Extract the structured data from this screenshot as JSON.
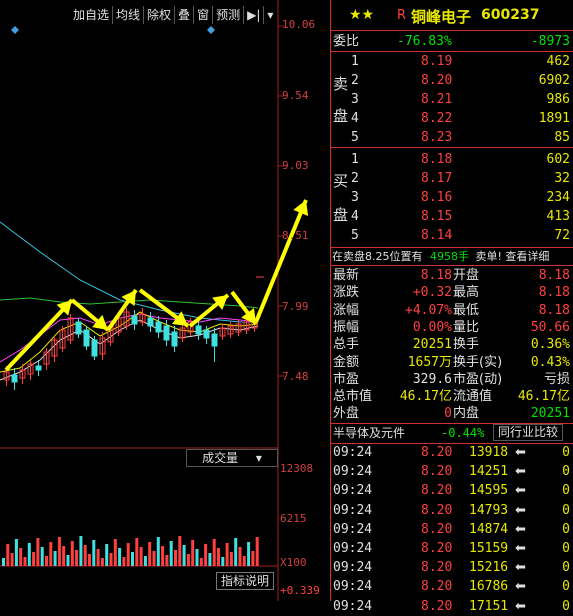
{
  "toolbar": {
    "items": [
      "加自选",
      "均线",
      "除权",
      "叠",
      "窗",
      "预测"
    ],
    "more_icon": "arrow-to-right-icon"
  },
  "price_axis": [
    "10.06",
    "9.54",
    "9.03",
    "8.51",
    "7.99",
    "7.48"
  ],
  "volume_axis": [
    "12308",
    "6215"
  ],
  "volume_unit": "X100",
  "indicator_value": "+0.339",
  "indicator_select": "成交量",
  "indicator_help": "指标说明",
  "header": {
    "stars": "★★",
    "flag": "R",
    "name": "铜峰电子",
    "code": "600237"
  },
  "weibi": {
    "label": "委比",
    "pct": "-76.83%",
    "diff": "-8973"
  },
  "sell": {
    "label": [
      "卖",
      "盘"
    ],
    "levels": [
      {
        "n": "5",
        "price": "8.23",
        "vol": "85"
      },
      {
        "n": "4",
        "price": "8.22",
        "vol": "1891"
      },
      {
        "n": "3",
        "price": "8.21",
        "vol": "986"
      },
      {
        "n": "2",
        "price": "8.20",
        "vol": "6902"
      },
      {
        "n": "1",
        "price": "8.19",
        "vol": "462"
      }
    ]
  },
  "buy": {
    "label": [
      "买",
      "盘"
    ],
    "levels": [
      {
        "n": "1",
        "price": "8.18",
        "vol": "602"
      },
      {
        "n": "2",
        "price": "8.17",
        "vol": "32"
      },
      {
        "n": "3",
        "price": "8.16",
        "vol": "234"
      },
      {
        "n": "4",
        "price": "8.15",
        "vol": "413"
      },
      {
        "n": "5",
        "price": "8.14",
        "vol": "72"
      }
    ]
  },
  "notice": {
    "text": "在卖盘8.25位置有",
    "vol": "4958手",
    "action": "卖单!",
    "link": "查看详细"
  },
  "stats": [
    {
      "l1": "最新",
      "v1": "8.18",
      "c1": "red",
      "l2": "开盘",
      "v2": "8.18",
      "c2": "red"
    },
    {
      "l1": "涨跌",
      "v1": "+0.32",
      "c1": "red",
      "l2": "最高",
      "v2": "8.18",
      "c2": "red"
    },
    {
      "l1": "涨幅",
      "v1": "+4.07%",
      "c1": "red",
      "l2": "最低",
      "v2": "8.18",
      "c2": "red"
    },
    {
      "l1": "振幅",
      "v1": "0.00%",
      "c1": "red",
      "l2": "量比",
      "v2": "50.66",
      "c2": "red"
    },
    {
      "l1": "总手",
      "v1": "20251",
      "c1": "yellow",
      "l2": "换手",
      "v2": "0.36%",
      "c2": "yellow"
    },
    {
      "l1": "金额",
      "v1": "1657万",
      "c1": "yellow",
      "l2": "换手(实)",
      "v2": "0.43%",
      "c2": "yellow"
    },
    {
      "l1": "市盈",
      "v1": "329.6",
      "c1": "white",
      "l2": "市盈(动)",
      "v2": "亏损",
      "c2": "white"
    },
    {
      "l1": "总市值",
      "v1": "46.17亿",
      "c1": "yellow",
      "l2": "流通值",
      "v2": "46.17亿",
      "c2": "yellow"
    },
    {
      "l1": "外盘",
      "v1": "0",
      "c1": "red",
      "l2": "内盘",
      "v2": "20251",
      "c2": "green"
    }
  ],
  "sector": {
    "name": "半导体及元件",
    "change": "-0.44%",
    "compare": "同行业比较"
  },
  "ticks": [
    {
      "time": "09:24",
      "price": "8.20",
      "vol": "13918",
      "arrow": "⬅",
      "n": "0"
    },
    {
      "time": "09:24",
      "price": "8.20",
      "vol": "14251",
      "arrow": "⬅",
      "n": "0"
    },
    {
      "time": "09:24",
      "price": "8.20",
      "vol": "14595",
      "arrow": "⬅",
      "n": "0"
    },
    {
      "time": "09:24",
      "price": "8.20",
      "vol": "14793",
      "arrow": "⬅",
      "n": "0"
    },
    {
      "time": "09:24",
      "price": "8.20",
      "vol": "14874",
      "arrow": "⬅",
      "n": "0"
    },
    {
      "time": "09:24",
      "price": "8.20",
      "vol": "15159",
      "arrow": "⬅",
      "n": "0"
    },
    {
      "time": "09:24",
      "price": "8.20",
      "vol": "15216",
      "arrow": "⬅",
      "n": "0"
    },
    {
      "time": "09:24",
      "price": "8.20",
      "vol": "16786",
      "arrow": "⬅",
      "n": "0"
    },
    {
      "time": "09:24",
      "price": "8.20",
      "vol": "17151",
      "arrow": "⬅",
      "n": "0"
    }
  ],
  "colors": {
    "up": "#ff4040",
    "down": "#40e0e0",
    "arrow": "#ffff00",
    "ma_white": "#e0e0e0",
    "ma_yellow": "#e8e800",
    "ma_magenta": "#ff40ff",
    "ma_green": "#30c030",
    "ma_cyan": "#40c0e0"
  }
}
